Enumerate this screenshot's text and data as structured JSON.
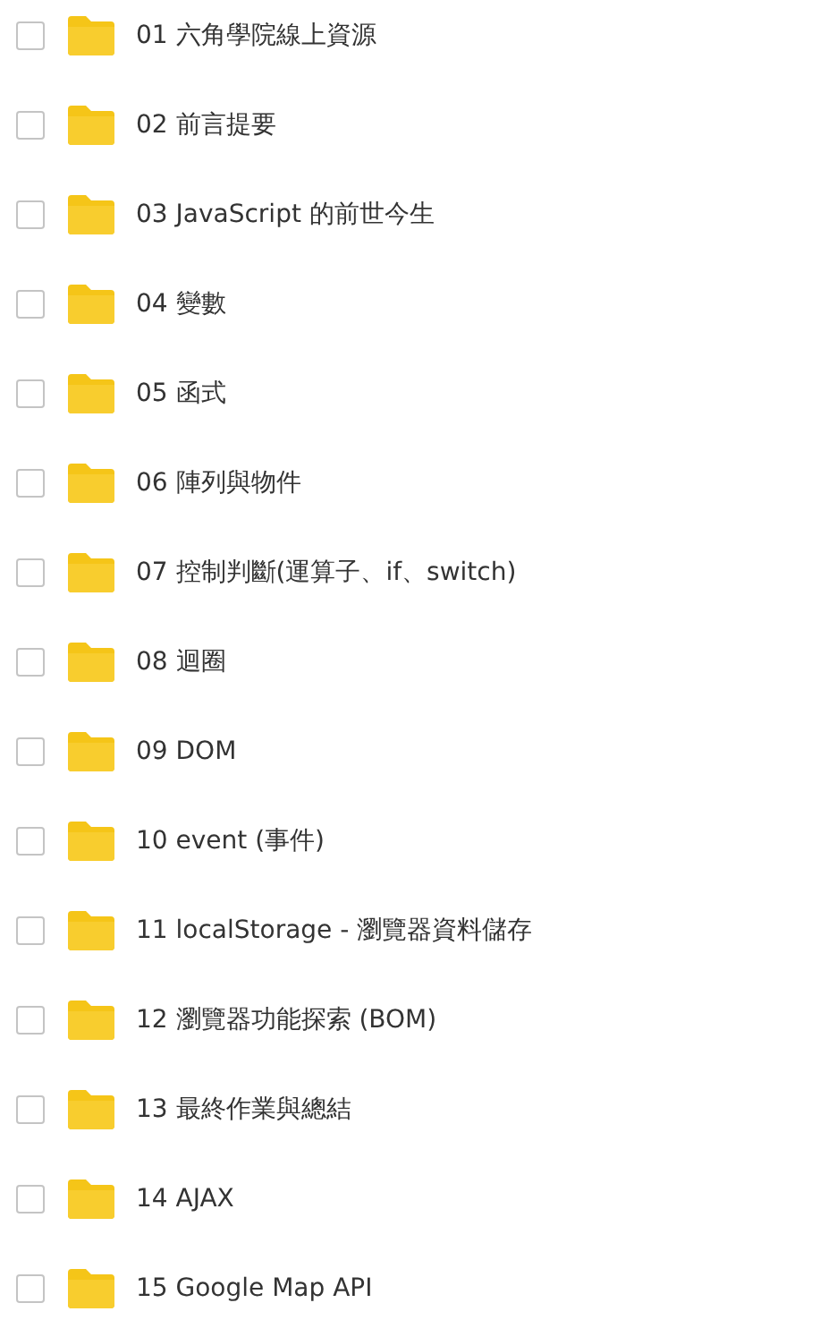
{
  "folders": [
    {
      "name": "01 六角學院線上資源",
      "checked": false
    },
    {
      "name": "02 前言提要",
      "checked": false
    },
    {
      "name": "03 JavaScript 的前世今生",
      "checked": false
    },
    {
      "name": "04 變數",
      "checked": false
    },
    {
      "name": "05 函式",
      "checked": false
    },
    {
      "name": "06 陣列與物件",
      "checked": false
    },
    {
      "name": "07 控制判斷(運算子、if、switch)",
      "checked": false
    },
    {
      "name": "08 迴圈",
      "checked": false
    },
    {
      "name": "09 DOM",
      "checked": false
    },
    {
      "name": "10 event (事件)",
      "checked": false
    },
    {
      "name": "11 localStorage - 瀏覽器資料儲存",
      "checked": false
    },
    {
      "name": "12 瀏覽器功能探索 (BOM)",
      "checked": false
    },
    {
      "name": "13 最終作業與總結",
      "checked": false
    },
    {
      "name": "14 AJAX",
      "checked": false
    },
    {
      "name": "15 Google Map API",
      "checked": false
    }
  ]
}
